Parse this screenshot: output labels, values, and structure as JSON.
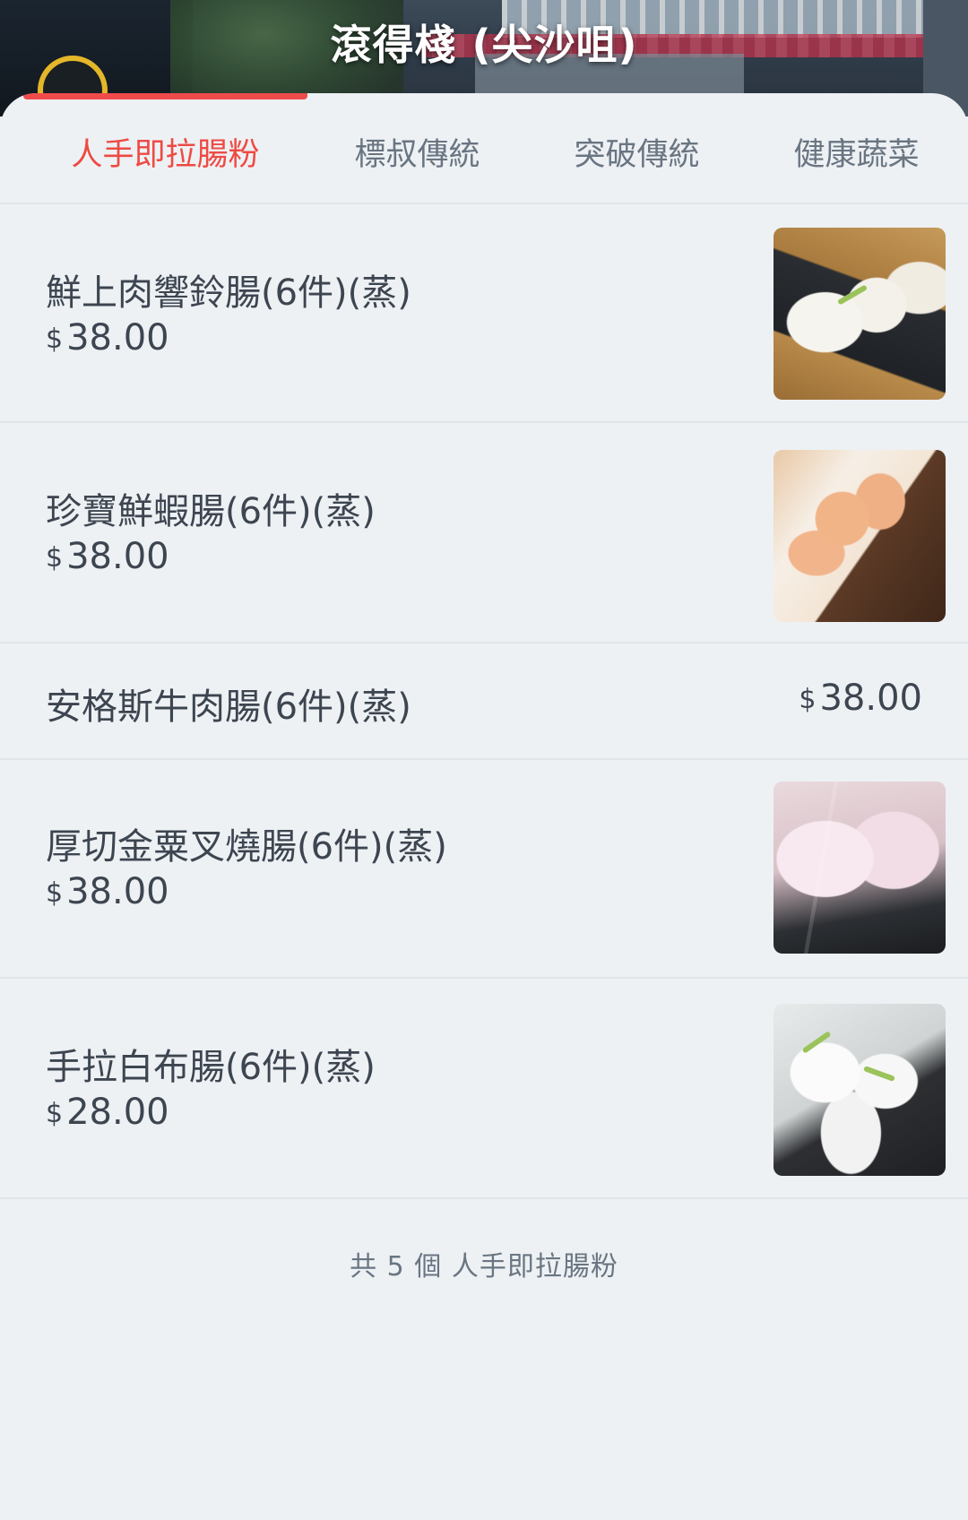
{
  "header": {
    "store_name": "滾得棧 (尖沙咀)"
  },
  "tabs": [
    {
      "label": "人手即拉腸粉",
      "active": true
    },
    {
      "label": "標叔傳統",
      "active": false
    },
    {
      "label": "突破傳統",
      "active": false
    },
    {
      "label": "健康蔬菜",
      "active": false
    }
  ],
  "currency_symbol": "$",
  "items": [
    {
      "name": "鮮上肉響鈴腸(6件)(蒸)",
      "price": "38.00",
      "image": "steamed-rice-roll-fried-dough-photo"
    },
    {
      "name": "珍寶鮮蝦腸(6件)(蒸)",
      "price": "38.00",
      "image": "shrimp-rice-roll-photo"
    },
    {
      "name": "安格斯牛肉腸(6件)(蒸)",
      "price": "38.00"
    },
    {
      "name": "厚切金粟叉燒腸(6件)(蒸)",
      "price": "38.00",
      "image": "char-siu-rice-roll-photo"
    },
    {
      "name": "手拉白布腸(6件)(蒸)",
      "price": "28.00",
      "image": "plain-rice-roll-photo"
    }
  ],
  "footer": {
    "count_text": "共 5 個 人手即拉腸粉"
  },
  "colors": {
    "accent": "#ee4a43",
    "background": "#edf1f4",
    "text": "#3d4550",
    "muted": "#6a7582"
  }
}
